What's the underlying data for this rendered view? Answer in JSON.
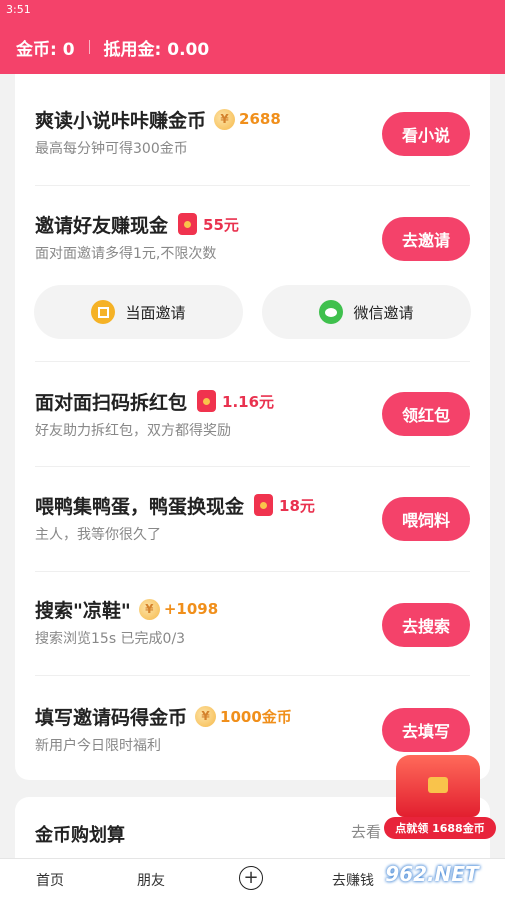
{
  "status_bar": {
    "time": "3:51"
  },
  "header": {
    "coins_label": "金币: 0",
    "deduct_label": "抵用金: 0.00"
  },
  "tasks": [
    {
      "title": "爽读小说咔咔赚金币",
      "reward": "2688",
      "subtitle": "最高每分钟可得300金币",
      "button": "看小说"
    },
    {
      "title": "邀请好友赚现金",
      "reward": "55元",
      "subtitle": "面对面邀请多得1元,不限次数",
      "button": "去邀请"
    },
    {
      "title": "面对面扫码拆红包",
      "reward": "1.16元",
      "subtitle": "好友助力拆红包，双方都得奖励",
      "button": "领红包"
    },
    {
      "title": "喂鸭集鸭蛋，鸭蛋换现金",
      "reward": "18元",
      "subtitle": "主人，我等你很久了",
      "button": "喂饲料"
    },
    {
      "title": "搜索\"凉鞋\"",
      "reward": "+1098",
      "subtitle": "搜索浏览15s 已完成0/3",
      "button": "去搜索"
    },
    {
      "title": "填写邀请码得金币",
      "reward": "1000金币",
      "subtitle": "新用户今日限时福利",
      "button": "去填写"
    }
  ],
  "invite_options": {
    "face_to_face": "当面邀请",
    "wechat": "微信邀请"
  },
  "coin_section": {
    "title": "金币购划算",
    "link": "去看"
  },
  "promo": {
    "label": "点就领 1688金币"
  },
  "bottom_nav": {
    "home": "首页",
    "friends": "朋友",
    "earn": "去赚钱"
  },
  "watermark": "962.NET",
  "colors": {
    "accent": "#f4426a",
    "reward_gold": "#f08f1b",
    "reward_red": "#e9324f"
  }
}
